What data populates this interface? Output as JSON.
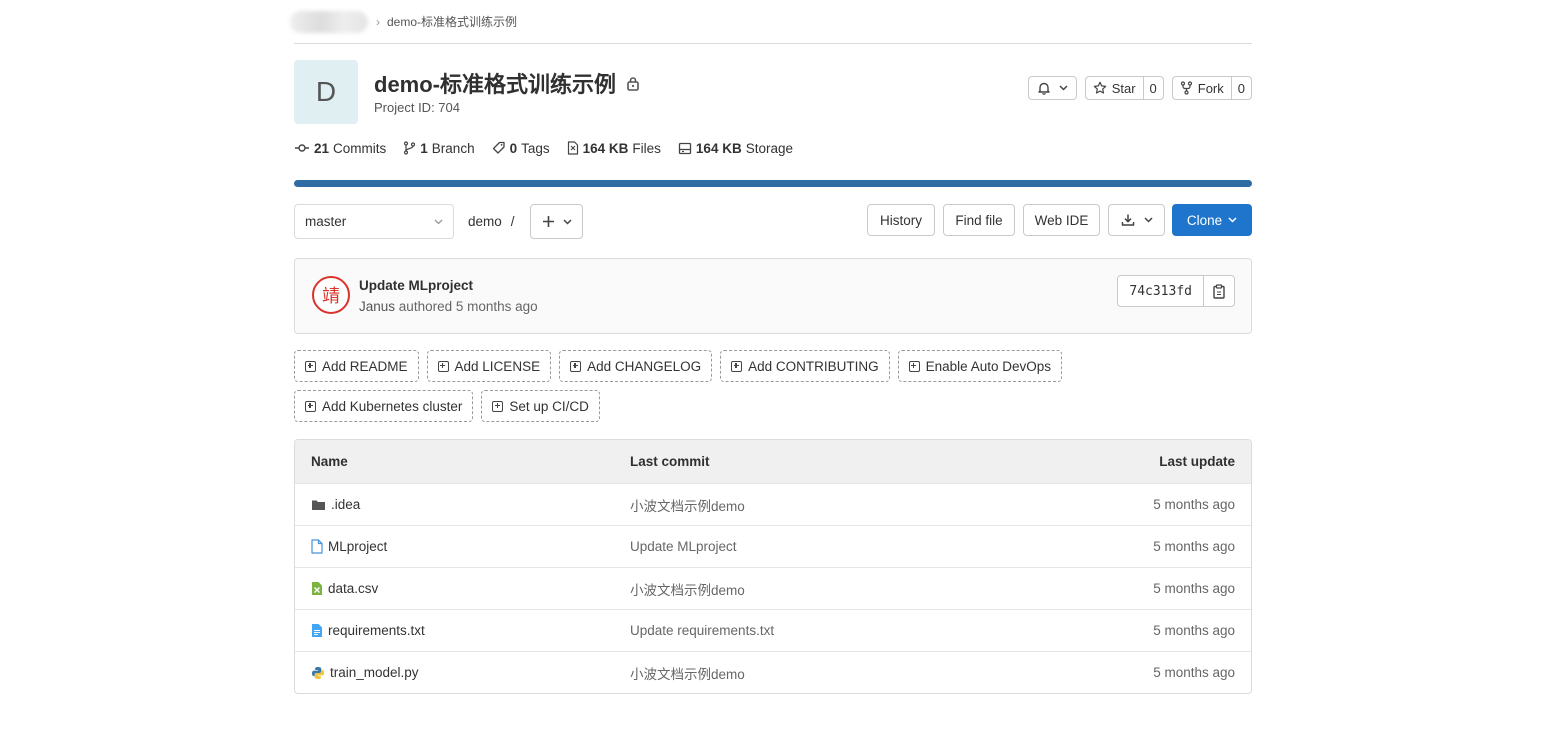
{
  "breadcrumb": {
    "separator": "›",
    "current": "demo-标准格式训练示例"
  },
  "project": {
    "avatar_letter": "D",
    "title": "demo-标准格式训练示例",
    "id_text": "Project ID: 704",
    "star_label": "Star",
    "star_count": "0",
    "fork_label": "Fork",
    "fork_count": "0"
  },
  "stats": {
    "commits_num": "21",
    "commits_label": "Commits",
    "branch_num": "1",
    "branch_label": "Branch",
    "tags_num": "0",
    "tags_label": "Tags",
    "files_num": "164 KB",
    "files_label": "Files",
    "storage_num": "164 KB",
    "storage_label": "Storage"
  },
  "toolbar": {
    "branch": "master",
    "path": "demo",
    "path_sep": "/",
    "history": "History",
    "find_file": "Find file",
    "web_ide": "Web IDE",
    "clone": "Clone"
  },
  "commit": {
    "title": "Update MLproject",
    "author": "Janus",
    "meta": "authored 5 months ago",
    "sha": "74c313fd",
    "avatar_glyph": "靖"
  },
  "suggestions": [
    "Add README",
    "Add LICENSE",
    "Add CHANGELOG",
    "Add CONTRIBUTING",
    "Enable Auto DevOps",
    "Add Kubernetes cluster",
    "Set up CI/CD"
  ],
  "table": {
    "headers": {
      "name": "Name",
      "last_commit": "Last commit",
      "last_update": "Last update"
    },
    "rows": [
      {
        "name": ".idea",
        "commit": "小波文档示例demo",
        "update": "5 months ago"
      },
      {
        "name": "MLproject",
        "commit": "Update MLproject",
        "update": "5 months ago"
      },
      {
        "name": "data.csv",
        "commit": "小波文档示例demo",
        "update": "5 months ago"
      },
      {
        "name": "requirements.txt",
        "commit": "Update requirements.txt",
        "update": "5 months ago"
      },
      {
        "name": "train_model.py",
        "commit": "小波文档示例demo",
        "update": "5 months ago"
      }
    ]
  },
  "colors": {
    "progress": "#2f6ca3",
    "primary": "#1f75cb",
    "avatar_bg": "#e0f0f2"
  }
}
